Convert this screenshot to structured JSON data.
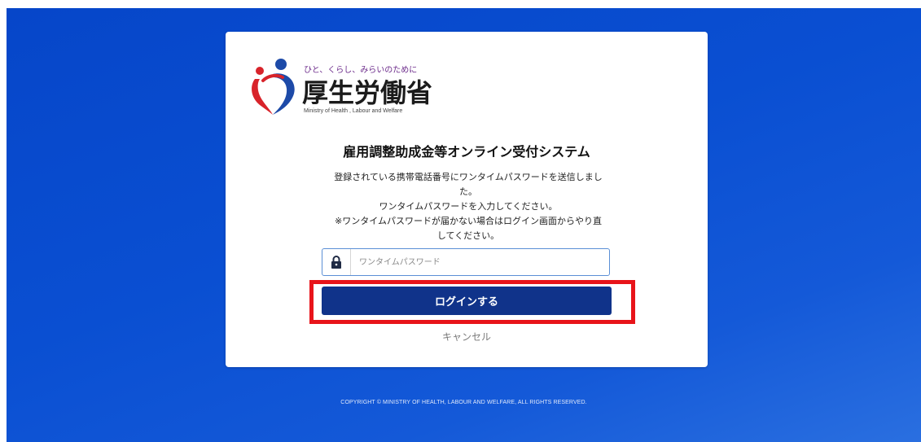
{
  "logo": {
    "tagline": "ひと、くらし、みらいのために",
    "name": "厚生労働省",
    "english": "Ministry of Health , Labour and Welfare"
  },
  "card": {
    "system_title": "雇用調整助成金等オンライン受付システム",
    "message_lines": [
      "登録されている携帯電話番号にワンタイムパスワードを送信しまし",
      "た。",
      "ワンタイムパスワードを入力してください。",
      "※ワンタイムパスワードが届かない場合はログイン画面からやり直",
      "してください。"
    ],
    "otp_input": {
      "placeholder": "ワンタイムパスワード",
      "value": ""
    },
    "login_label": "ログインする",
    "cancel_label": "キャンセル"
  },
  "footer": {
    "copyright": "COPYRIGHT © MINISTRY OF HEALTH, LABOUR AND WELFARE, ALL RIGHTS RESERVED."
  },
  "colors": {
    "background": "#0a4fd2",
    "button": "#10338a",
    "highlight": "#e8141a",
    "logo_red": "#d8232a",
    "logo_blue": "#1d4aa8"
  },
  "icons": {
    "logo_mark": "ministry-logo-mark",
    "input_icon": "lock-icon"
  }
}
